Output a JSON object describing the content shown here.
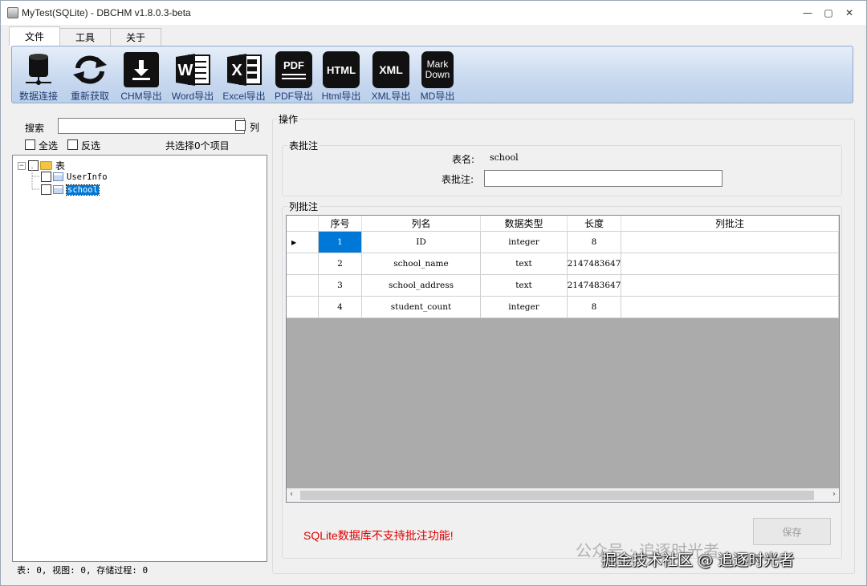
{
  "window": {
    "title": "MyTest(SQLite) - DBCHM v1.8.0.3-beta"
  },
  "tabs": [
    {
      "label": "文件",
      "active": true
    },
    {
      "label": "工具",
      "active": false
    },
    {
      "label": "关于",
      "active": false
    }
  ],
  "toolbar": [
    {
      "label": "数据连接",
      "icon": "database-connection-icon"
    },
    {
      "label": "重新获取",
      "icon": "refresh-icon"
    },
    {
      "label": "CHM导出",
      "icon": "download-icon"
    },
    {
      "label": "Word导出",
      "icon": "word-icon"
    },
    {
      "label": "Excel导出",
      "icon": "excel-icon"
    },
    {
      "label": "PDF导出",
      "icon": "pdf-icon",
      "badge": "PDF"
    },
    {
      "label": "Html导出",
      "icon": "html-icon",
      "badge": "HTML"
    },
    {
      "label": "XML导出",
      "icon": "xml-icon",
      "badge": "XML"
    },
    {
      "label": "MD导出",
      "icon": "markdown-icon",
      "badge": "Mark Down"
    }
  ],
  "left": {
    "search_label": "搜索",
    "search_value": "",
    "col_checkbox_label": "列",
    "select_all_label": "全选",
    "invert_label": "反选",
    "selected_count": "共选择0个项目",
    "tree": {
      "root": "表",
      "items": [
        "UserInfo",
        "school"
      ],
      "selected": "school"
    }
  },
  "status": "表: 0, 视图: 0, 存储过程: 0",
  "ops": {
    "title": "操作",
    "table_comment_group": "表批注",
    "table_name_label": "表名:",
    "table_name_value": "school",
    "table_comment_label": "表批注:",
    "table_comment_value": "",
    "column_comment_group": "列批注"
  },
  "grid": {
    "headers": [
      "序号",
      "列名",
      "数据类型",
      "长度",
      "列批注"
    ],
    "rows": [
      [
        "1",
        "ID",
        "integer",
        "8",
        ""
      ],
      [
        "2",
        "school_name",
        "text",
        "2147483647",
        ""
      ],
      [
        "3",
        "school_address",
        "text",
        "2147483647",
        ""
      ],
      [
        "4",
        "student_count",
        "integer",
        "8",
        ""
      ]
    ]
  },
  "save_label": "保存",
  "warning": "SQLite数据库不支持批注功能!",
  "watermark_top": "公众号 · 追逐时光者",
  "watermark_bottom": "掘金技术社区 @ 追逐时光者",
  "colors": {
    "ribbon": "#c7d8ef",
    "selected": "#0078d7",
    "warning": "#e00000"
  }
}
